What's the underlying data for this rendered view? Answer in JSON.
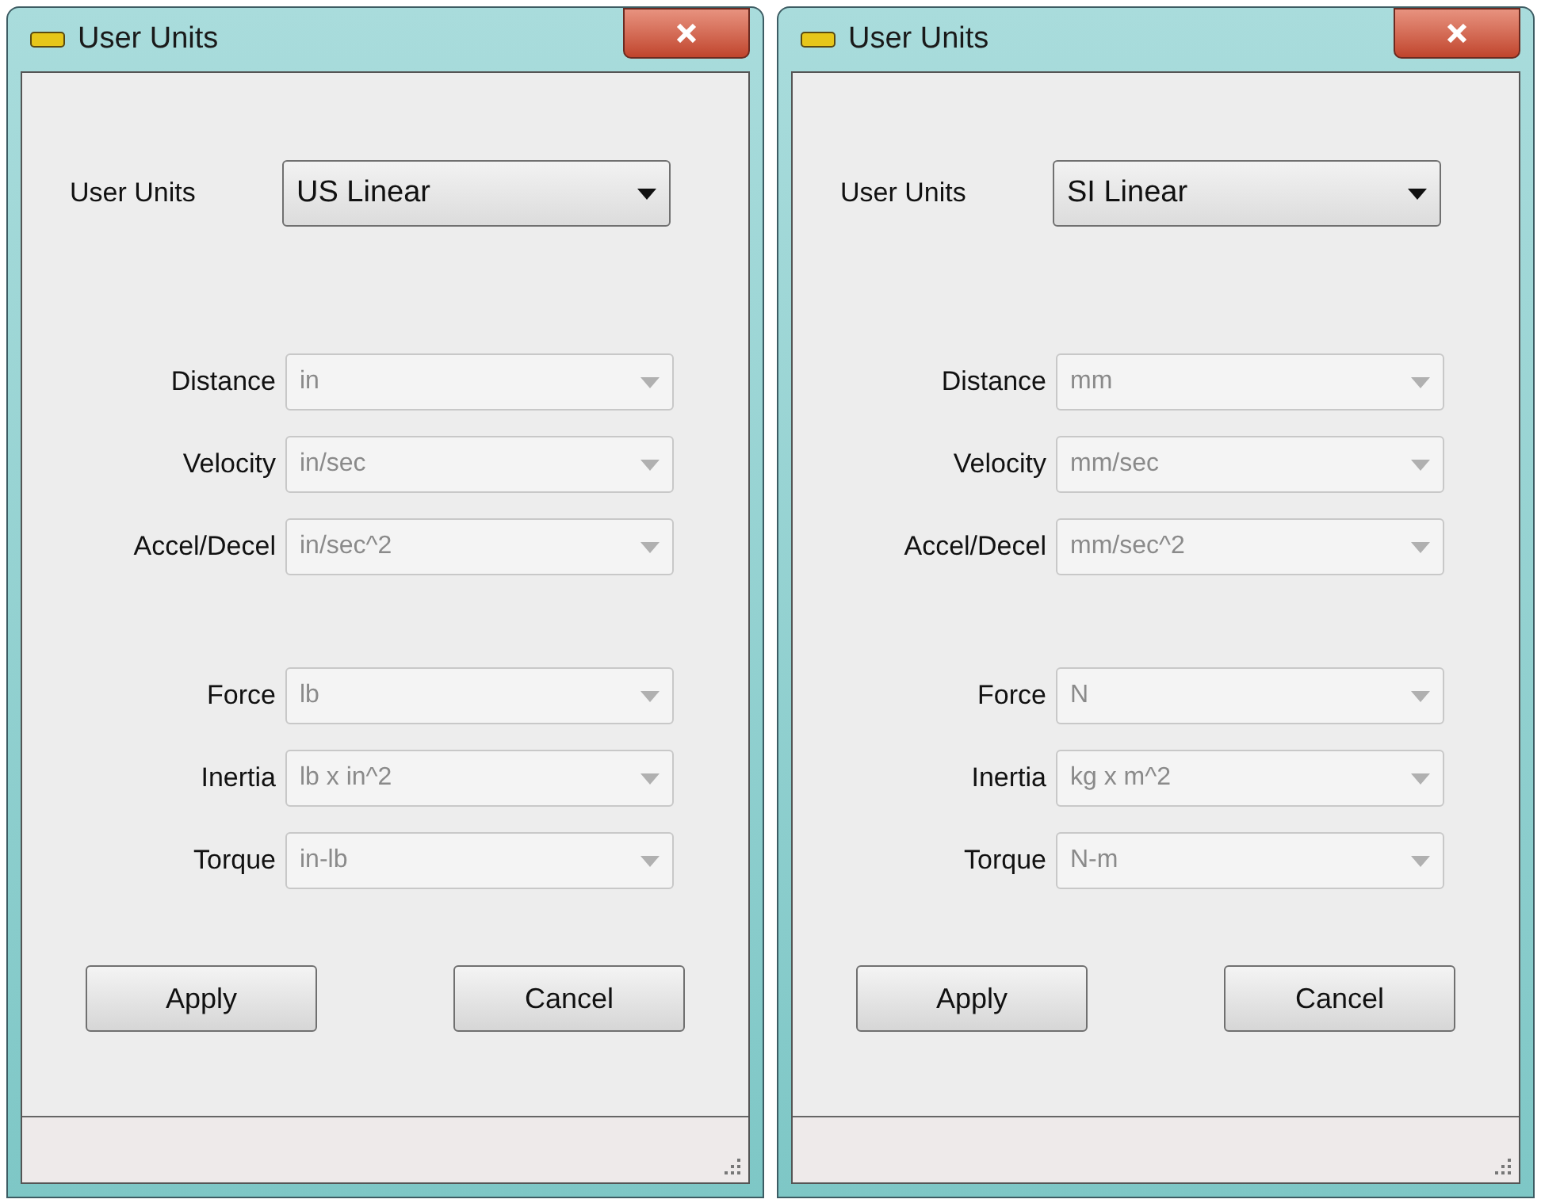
{
  "windows": [
    {
      "title": "User Units",
      "user_units": {
        "label": "User Units",
        "value": "US Linear",
        "disabled": false
      },
      "groups": [
        [
          {
            "label": "Distance",
            "value": "in",
            "disabled": true
          },
          {
            "label": "Velocity",
            "value": "in/sec",
            "disabled": true
          },
          {
            "label": "Accel/Decel",
            "value": "in/sec^2",
            "disabled": true
          }
        ],
        [
          {
            "label": "Force",
            "value": "lb",
            "disabled": true
          },
          {
            "label": "Inertia",
            "value": "lb x in^2",
            "disabled": true
          },
          {
            "label": "Torque",
            "value": "in-lb",
            "disabled": true
          }
        ]
      ],
      "buttons": [
        "Apply",
        "Cancel"
      ]
    },
    {
      "title": "User Units",
      "user_units": {
        "label": "User Units",
        "value": "SI Linear",
        "disabled": false
      },
      "groups": [
        [
          {
            "label": "Distance",
            "value": "mm",
            "disabled": true
          },
          {
            "label": "Velocity",
            "value": "mm/sec",
            "disabled": true
          },
          {
            "label": "Accel/Decel",
            "value": "mm/sec^2",
            "disabled": true
          }
        ],
        [
          {
            "label": "Force",
            "value": "N",
            "disabled": true
          },
          {
            "label": "Inertia",
            "value": "kg x m^2",
            "disabled": true
          },
          {
            "label": "Torque",
            "value": "N-m",
            "disabled": true
          }
        ]
      ],
      "buttons": [
        "Apply",
        "Cancel"
      ]
    }
  ]
}
